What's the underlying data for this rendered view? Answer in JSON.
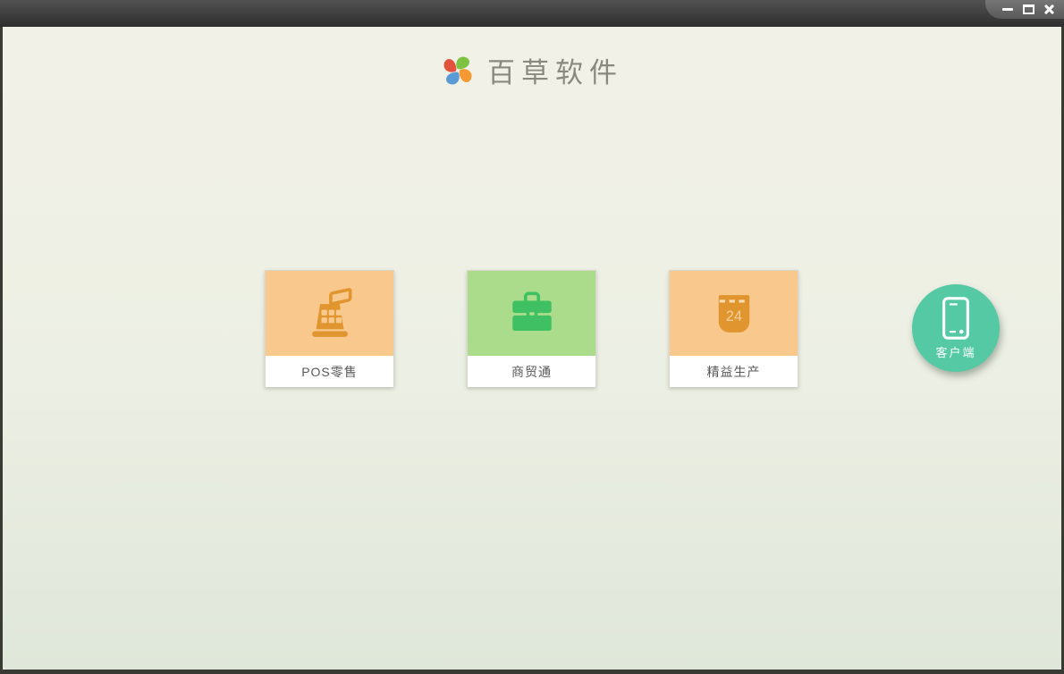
{
  "window": {
    "controls": {
      "minimize": "minimize-icon",
      "maximize": "maximize-icon",
      "close": "close-icon"
    }
  },
  "header": {
    "logo": "pinwheel-logo-icon",
    "title": "百草软件"
  },
  "products": [
    {
      "label": "POS零售",
      "icon": "cash-register-icon",
      "tile_color": "#f8c88d",
      "icon_color": "#e0952e"
    },
    {
      "label": "商贸通",
      "icon": "briefcase-icon",
      "tile_color": "#aadc8b",
      "icon_color": "#3fc163"
    },
    {
      "label": "精益生产",
      "icon": "calendar-icon",
      "tile_color": "#f8c88d",
      "icon_color": "#e0952e",
      "calendar_day": "24"
    }
  ],
  "client_button": {
    "label": "客户端",
    "icon": "smartphone-icon",
    "color": "#54c9a4"
  },
  "colors": {
    "titlebar_dark": "#303030",
    "background_top": "#f2f1e8",
    "background_bottom": "#dfe7da",
    "logo_green": "#7dc242",
    "logo_orange": "#f59a33",
    "logo_blue": "#5b9bd5",
    "logo_red": "#e2523c",
    "card_label_text": "#595959"
  }
}
